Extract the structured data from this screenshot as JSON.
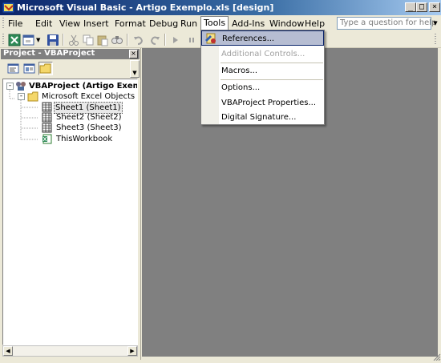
{
  "window": {
    "title": "Microsoft Visual Basic - Artigo Exemplo.xls [design]",
    "minimize": "_",
    "maximize": "□",
    "close": "×"
  },
  "menubar": {
    "items": [
      "File",
      "Edit",
      "View",
      "Insert",
      "Format",
      "Debug",
      "Run",
      "Tools",
      "Add-Ins",
      "Window",
      "Help"
    ],
    "active": "Tools",
    "help_placeholder": "Type a question for help"
  },
  "tools_menu": {
    "items": [
      {
        "label": "References...",
        "enabled": true,
        "highlighted": true,
        "icon": "references-icon"
      },
      {
        "label": "Additional Controls...",
        "enabled": false
      },
      {
        "label": "Macros...",
        "enabled": true
      },
      {
        "label": "Options...",
        "enabled": true
      },
      {
        "label": "VBAProject Properties...",
        "enabled": true
      },
      {
        "label": "Digital Signature...",
        "enabled": true
      }
    ]
  },
  "project_panel": {
    "title": "Project - VBAProject",
    "close": "×",
    "tree": {
      "root": "VBAProject (Artigo Exemplo",
      "folder": "Microsoft Excel Objects",
      "sheets": [
        "Sheet1 (Sheet1)",
        "Sheet2 (Sheet2)",
        "Sheet3 (Sheet3)"
      ],
      "workbook": "ThisWorkbook",
      "selected": "Sheet1 (Sheet1)"
    }
  },
  "colors": {
    "title_gradient_start": "#0a246a",
    "title_gradient_end": "#a6caf0",
    "workspace": "#808080",
    "menu_highlight": "#b6bdd2"
  }
}
